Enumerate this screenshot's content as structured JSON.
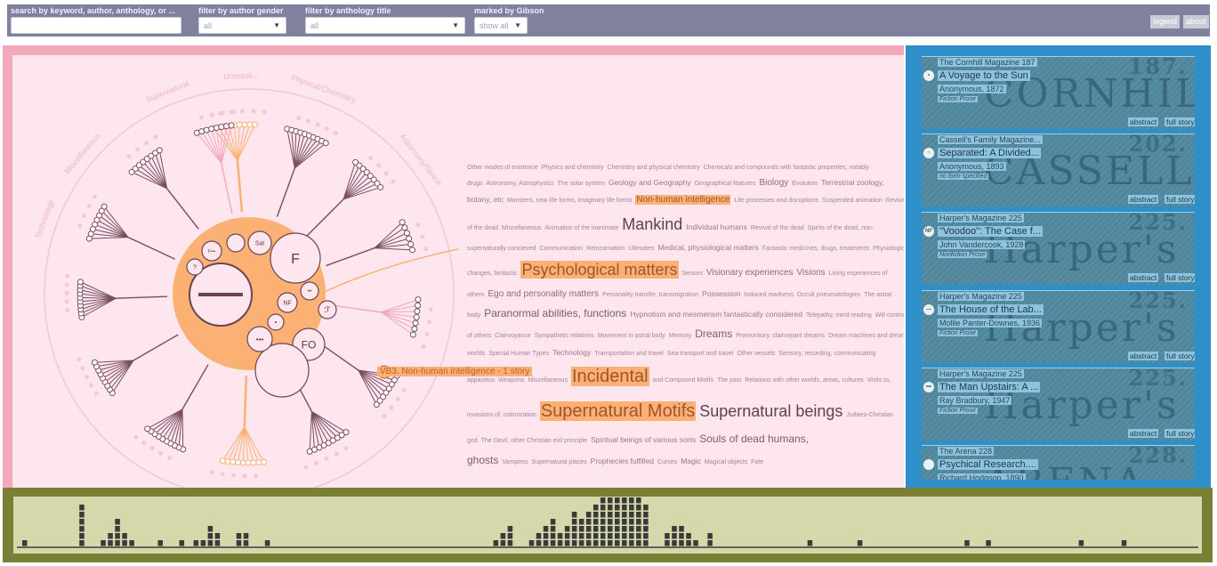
{
  "topbar": {
    "search_label": "search by keyword, author, anthology, or ...",
    "search_value": "",
    "gender_label": "filter by author gender",
    "gender_value": "all",
    "anthology_label": "filter by anthology title",
    "anthology_value": "all",
    "gibson_label": "marked by Gibson",
    "gibson_value": "show all",
    "legend_label": "legend",
    "about_label": "about"
  },
  "tree": {
    "nodes": {
      "fiction_label": "F",
      "nonfiction_label": "NF",
      "fo_label": "FO",
      "sat_label": "Sat",
      "f_dots_label": "F•••",
      "question_label": "?",
      "small_f_label": "ℱ",
      "ellipsis_label": "•••",
      "colon_label": "••",
      "dot_label": "•"
    },
    "ring_labels": [
      "Supernatural",
      "Unmask...",
      "Physical/Chemistry",
      "Astronomy/Space",
      "Technology",
      "Miscellaneous"
    ],
    "tooltip": "VB3. Non-human intelligence - 1 story",
    "colors": {
      "accent": "#fbb174",
      "branch": "#7a4d60",
      "node_stroke": "#7a4d60"
    }
  },
  "cloud": [
    {
      "t": "Other modes of existence",
      "s": 1
    },
    {
      "t": "Physics and chemistry",
      "s": 1
    },
    {
      "t": "Chemistry and physical chemistry",
      "s": 1
    },
    {
      "t": "Chemicals and compounds with fantastic properties, notably drugs",
      "s": 1
    },
    {
      "t": "Astronomy, Astrophysics",
      "s": 1
    },
    {
      "t": "The solar system",
      "s": 1
    },
    {
      "t": "Geology and Geography",
      "s": 2
    },
    {
      "t": "Geographical features",
      "s": 1
    },
    {
      "t": "Biology",
      "s": 3
    },
    {
      "t": "Evolution",
      "s": 1
    },
    {
      "t": "Terrestrial zoology, botany, etc",
      "s": 2
    },
    {
      "t": "Monsters, new life forms, imaginary life forms",
      "s": 1
    },
    {
      "t": "Non-human intelligence",
      "s": 3,
      "hl": true
    },
    {
      "t": "Life processes and disruptions",
      "s": 1
    },
    {
      "t": "Suspended animation",
      "s": 1
    },
    {
      "t": "Revival of the dead",
      "s": 1
    },
    {
      "t": "Miscellaneous",
      "s": 1
    },
    {
      "t": "Animation of the inanimate",
      "s": 1
    },
    {
      "t": "Mankind",
      "s": 6
    },
    {
      "t": "Individual humans",
      "s": 2
    },
    {
      "t": "Revival of the dead",
      "s": 1
    },
    {
      "t": "Spirits of the dead, non-supernaturally concieved",
      "s": 1
    },
    {
      "t": "Communication",
      "s": 1
    },
    {
      "t": "Reincarnation",
      "s": 1
    },
    {
      "t": "Ultimates",
      "s": 1
    },
    {
      "t": "Medical, physiological matters",
      "s": 2
    },
    {
      "t": "Fantastic medicines, drugs, treatments",
      "s": 1
    },
    {
      "t": "Physiological changes, fantastic",
      "s": 1
    },
    {
      "t": "Psychological matters",
      "s": 6,
      "hl": true
    },
    {
      "t": "Senses",
      "s": 1
    },
    {
      "t": "Visionary experiences",
      "s": 3
    },
    {
      "t": "Visions",
      "s": 3
    },
    {
      "t": "Living experiences of others",
      "s": 1
    },
    {
      "t": "Ego and personality matters",
      "s": 3
    },
    {
      "t": "Personality transfer, transmigration",
      "s": 1
    },
    {
      "t": "Possession",
      "s": 2
    },
    {
      "t": "Induced madness",
      "s": 1
    },
    {
      "t": "Occult pneumatologies",
      "s": 1
    },
    {
      "t": "The astral body",
      "s": 1
    },
    {
      "t": "Paranormal abilities, functions",
      "s": 4
    },
    {
      "t": "Hypnotism and mesmerism fantastically considered",
      "s": 2
    },
    {
      "t": "Telepathy, mind reading",
      "s": 1
    },
    {
      "t": "Will control of others",
      "s": 1
    },
    {
      "t": "Clairvoyance",
      "s": 1
    },
    {
      "t": "Sympathetic relations",
      "s": 1
    },
    {
      "t": "Movement in astral body",
      "s": 1
    },
    {
      "t": "Memory",
      "s": 1
    },
    {
      "t": "Dreams",
      "s": 4
    },
    {
      "t": "Premonitory, clairvoyant dreams",
      "s": 1
    },
    {
      "t": "Dream machines and dream worlds",
      "s": 1
    },
    {
      "t": "Special Human Types",
      "s": 1
    },
    {
      "t": "Technology",
      "s": 2
    },
    {
      "t": "Transportation and travel",
      "s": 1
    },
    {
      "t": "Sea transport and travel",
      "s": 1
    },
    {
      "t": "Other vessels",
      "s": 1
    },
    {
      "t": "Sensory, recording, communicating apparatus",
      "s": 1
    },
    {
      "t": "Weapons",
      "s": 1
    },
    {
      "t": "Miscellaneous",
      "s": 1
    },
    {
      "t": "Incidental",
      "s": 7,
      "hl": true
    },
    {
      "t": "and Compound Motifs",
      "s": 1
    },
    {
      "t": "The past",
      "s": 1
    },
    {
      "t": "Relations with other worlds, areas, cultures",
      "s": 1
    },
    {
      "t": "Visits to, invasions of, colonization",
      "s": 1
    },
    {
      "t": "Supernatural Motifs",
      "s": 7,
      "hl": true
    },
    {
      "t": "Supernatural beings",
      "s": 6
    },
    {
      "t": "Judaeo-Christian god",
      "s": 1
    },
    {
      "t": "The Devil, other Christian evil principle",
      "s": 1
    },
    {
      "t": "Spiritual beings of various sorts",
      "s": 2
    },
    {
      "t": "Souls of dead humans, ghosts",
      "s": 4
    },
    {
      "t": "Vampires",
      "s": 1
    },
    {
      "t": "Supernatural places",
      "s": 1
    },
    {
      "t": "Prophecies fulfilled",
      "s": 2
    },
    {
      "t": "Curses",
      "s": 1
    },
    {
      "t": "Magic",
      "s": 2
    },
    {
      "t": "Magical objects",
      "s": 1
    },
    {
      "t": "Fate",
      "s": 1
    }
  ],
  "stories": [
    {
      "magazine": "The Cornhill Magazine 187",
      "title": "A Voyage to the Sun",
      "author": "Anonymous, 1872",
      "kind": "Fiction Prose",
      "icon": "•",
      "cover_no": "187.",
      "cover_name": "CORNHILL"
    },
    {
      "magazine": "Cassell's Family Magazine...",
      "title": "Separated: A Divided...",
      "author": "Anonymous, 1893",
      "kind": "no form specified",
      "icon": "○",
      "cover_no": "202.",
      "cover_name": "CASSELL'S"
    },
    {
      "magazine": "Harper's Magazine 225",
      "title": "\"Voodoo\": The Case f...",
      "author": "John Vandercook, 1928",
      "kind": "Nonfiction Prose",
      "icon": "NF",
      "cover_no": "225.",
      "cover_name": "Harper's"
    },
    {
      "magazine": "Harper's Magazine 225",
      "title": "The House of the Lab...",
      "author": "Mollie Panter-Downes, 1936",
      "kind": "Fiction Prose",
      "icon": "—",
      "cover_no": "225.",
      "cover_name": "Harper's"
    },
    {
      "magazine": "Harper's Magazine 225",
      "title": "The Man Upstairs: A ...",
      "author": "Ray Bradbury, 1947",
      "kind": "Fiction Prose",
      "icon": "•••",
      "cover_no": "225.",
      "cover_name": "Harper's"
    },
    {
      "magazine": "The Arena 228",
      "title": "Psychical Research....",
      "author": "Richard Hodgson, 1890",
      "kind": "",
      "icon": "",
      "cover_no": "228.",
      "cover_name": "ARENA"
    }
  ],
  "story_buttons": {
    "abstract": "abstract",
    "full": "full story"
  },
  "timeline": {
    "counts": [
      1,
      0,
      0,
      0,
      0,
      0,
      0,
      0,
      6,
      0,
      0,
      1,
      2,
      4,
      2,
      1,
      0,
      0,
      0,
      1,
      0,
      0,
      1,
      0,
      1,
      1,
      3,
      2,
      0,
      0,
      2,
      2,
      0,
      0,
      1,
      0,
      0,
      0,
      0,
      0,
      0,
      0,
      0,
      0,
      0,
      0,
      0,
      0,
      0,
      0,
      0,
      0,
      0,
      0,
      0,
      0,
      0,
      0,
      0,
      0,
      0,
      0,
      0,
      0,
      0,
      0,
      1,
      2,
      3,
      0,
      0,
      1,
      2,
      3,
      4,
      2,
      3,
      5,
      4,
      5,
      6,
      7,
      7,
      7,
      7,
      7,
      7,
      6,
      0,
      0,
      2,
      3,
      3,
      2,
      1,
      0,
      2,
      0,
      0,
      0,
      0,
      0,
      0,
      0,
      0,
      0,
      0,
      0,
      0,
      0,
      1,
      0,
      0,
      0,
      0,
      0,
      0,
      1,
      0,
      0,
      0,
      0,
      0,
      0,
      0,
      0,
      0,
      0,
      0,
      0,
      0,
      0,
      1,
      0,
      0,
      1,
      0,
      0,
      0,
      0,
      0,
      0,
      0,
      0,
      0,
      0,
      0,
      0,
      1,
      0,
      0,
      0,
      0,
      0,
      1,
      0,
      0,
      0,
      0,
      0,
      0,
      0,
      0,
      0
    ],
    "colors": {
      "bar": "#3a3a3a",
      "axis": "#3a3a3a"
    }
  }
}
